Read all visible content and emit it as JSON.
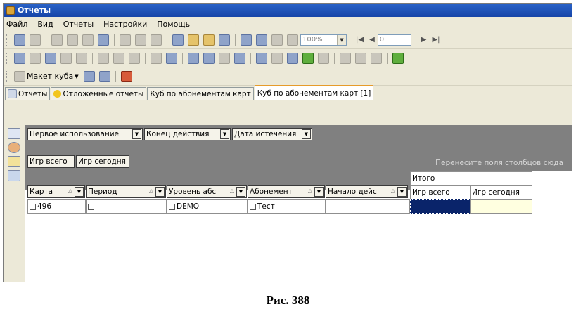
{
  "window": {
    "title": "Отчеты"
  },
  "menu": [
    "Файл",
    "Вид",
    "Отчеты",
    "Настройки",
    "Помощь"
  ],
  "toolbar": {
    "zoom": "100%",
    "page": "0",
    "cube_layout": "Макет куба"
  },
  "tabs": [
    {
      "label": "Отчеты",
      "active": false
    },
    {
      "label": "Отложенные отчеты",
      "active": false
    },
    {
      "label": "Куб по абонементам карт",
      "active": false
    },
    {
      "label": "Куб по абонементам карт [1]",
      "active": true
    }
  ],
  "pivot": {
    "filter_fields": [
      "Первое использование",
      "Конец действия",
      "Дата истечения"
    ],
    "data_fields": [
      "Игр всего",
      "Игр сегодня"
    ],
    "column_drop_hint": "Перенесите поля столбцов сюда",
    "row_fields": [
      "Карта",
      "Период",
      "Уровень абс",
      "Абонемент",
      "Начало дейс"
    ],
    "total_header": "Итого",
    "value_headers": [
      "Игр всего",
      "Игр сегодня"
    ],
    "row": {
      "card": "496",
      "period": "",
      "level": "DEMO",
      "subscription": "Тест",
      "start": ""
    },
    "colors": {
      "selected_cell": "#0a246a",
      "highlight_cell": "#ffffe0",
      "pivot_bg": "#808080"
    }
  },
  "caption": "Рис. 388"
}
